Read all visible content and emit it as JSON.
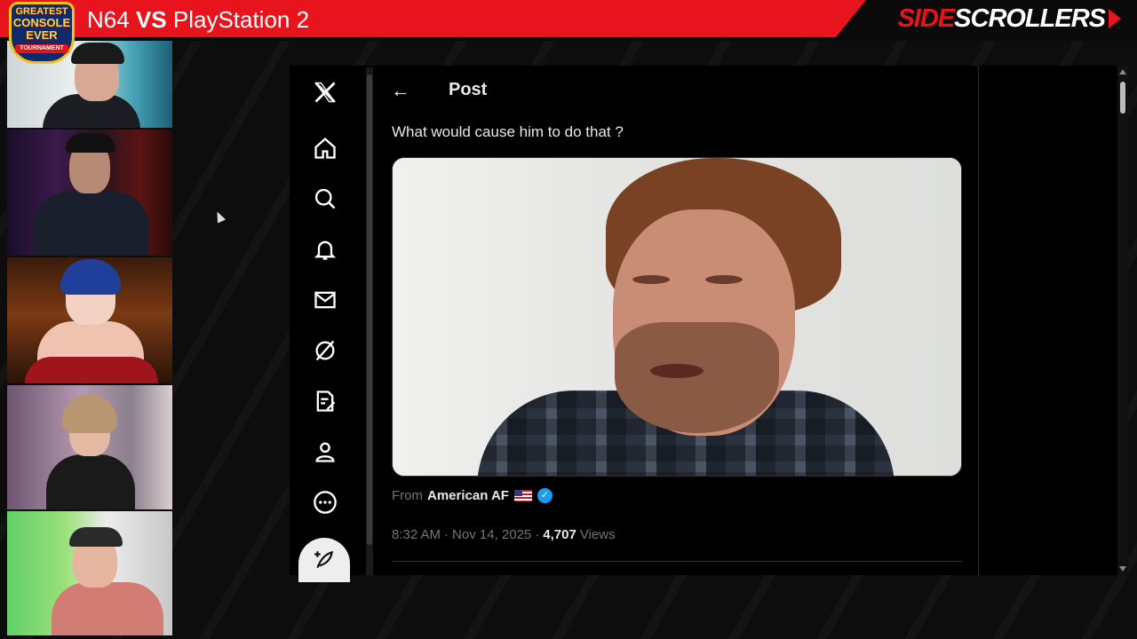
{
  "stream": {
    "title_left": "N64",
    "title_vs": "VS",
    "title_right": "PlayStation 2",
    "brand_side": "SIDE",
    "brand_scrollers": "SCROLLERS",
    "logo_lines": [
      "GREATEST",
      "CONSOLE",
      "EVER",
      "TOURNAMENT"
    ],
    "accent_color": "#e8141d"
  },
  "webcams": [
    {
      "name": "webcam-1"
    },
    {
      "name": "webcam-2"
    },
    {
      "name": "webcam-3"
    },
    {
      "name": "webcam-4"
    },
    {
      "name": "webcam-5"
    }
  ],
  "x_app": {
    "nav_icons": [
      "x-logo-icon",
      "home-icon",
      "search-icon",
      "bell-icon",
      "mail-icon",
      "grok-icon",
      "premium-icon",
      "profile-icon",
      "more-icon",
      "compose-icon"
    ],
    "header": {
      "back": "←",
      "title": "Post"
    },
    "post": {
      "text": "What would cause him to do that ?",
      "source_prefix": "From",
      "source_name": "American AF",
      "verified_mark": "✓",
      "time": "8:32 AM",
      "date": "Nov 14, 2025",
      "separator": "·",
      "views_count": "4,707",
      "views_label": "Views"
    }
  }
}
